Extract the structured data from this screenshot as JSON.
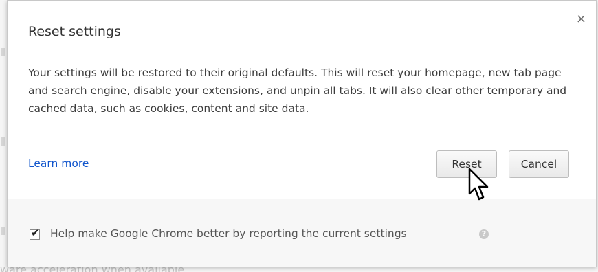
{
  "dialog": {
    "title": "Reset settings",
    "close_icon": "×",
    "body": "Your settings will be restored to their original defaults. This will reset your homepage, new tab page and search engine, disable your extensions, and unpin all tabs. It will also clear other temporary and cached data, such as cookies, content and site data.",
    "learn_more": "Learn more",
    "buttons": {
      "reset": "Reset",
      "cancel": "Cancel"
    },
    "footer": {
      "checkbox_checked": true,
      "checkbox_label": "Help make Google Chrome better by reporting the current settings",
      "help_icon": "?"
    }
  },
  "background": {
    "partial_text": "ware acceleration when available"
  },
  "colors": {
    "link": "#1155cc",
    "dialog_bg": "#ffffff",
    "footer_bg": "#f7f7f7"
  }
}
